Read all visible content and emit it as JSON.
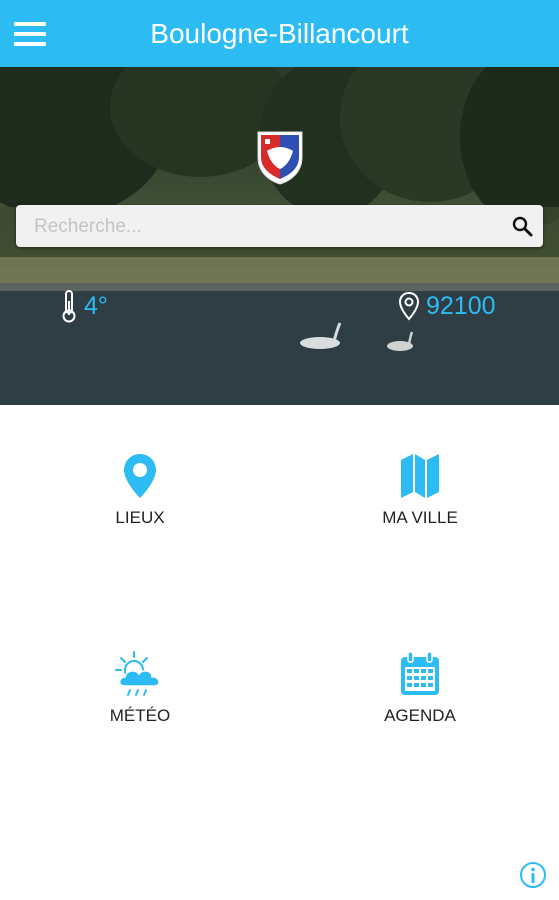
{
  "app": {
    "title": "Boulogne-Billancourt"
  },
  "header": {
    "menu_icon": "hamburger-menu-icon"
  },
  "hero": {
    "crest_icon": "city-coat-of-arms-icon",
    "search": {
      "placeholder": "Recherche...",
      "value": "",
      "icon": "search-icon"
    },
    "weather": {
      "icon": "thermometer-icon",
      "temperature": "4°"
    },
    "location": {
      "icon": "map-pin-outline-icon",
      "postal_code": "92100"
    }
  },
  "tiles": [
    {
      "label": "LIEUX",
      "icon": "map-pin-icon"
    },
    {
      "label": "MA VILLE",
      "icon": "folded-map-icon"
    },
    {
      "label": "MÉTÉO",
      "icon": "weather-sun-cloud-rain-icon"
    },
    {
      "label": "AGENDA",
      "icon": "calendar-icon"
    }
  ],
  "footer": {
    "info_icon": "info-icon"
  },
  "colors": {
    "accent": "#2cbcf3",
    "topbar": "#2cbcf3",
    "text": "#222222"
  }
}
